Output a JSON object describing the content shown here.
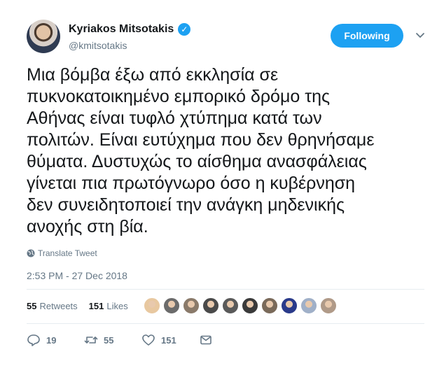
{
  "user": {
    "name": "Kyriakos Mitsotakis",
    "handle": "@kmitsotakis",
    "follow_label": "Following"
  },
  "tweet": {
    "text": "Μια βόμβα έξω από εκκλησία σε\nπυκνοκατοικημένο εμπορικό δρόμο της\nΑθήνας είναι τυφλό χτύπημα κατά των\nπολιτών. Είναι ευτύχημα που δεν θρηνήσαμε\nθύματα. Δυστυχώς το αίσθημα ανασφάλειας\nγίνεται πια πρωτόγνωρο όσο η κυβέρνηση\nδεν συνειδητοποιεί την ανάγκη μηδενικής\nανοχής στη βία.",
    "translate_label": "Translate Tweet",
    "timestamp": "2:53 PM - 27 Dec 2018"
  },
  "stats": {
    "retweets_count": "55",
    "retweets_label": "Retweets",
    "likes_count": "151",
    "likes_label": "Likes"
  },
  "liker_avatars": [
    {
      "color": "#e8c8a0"
    },
    {
      "color": "#6b6b6b"
    },
    {
      "color": "#8a7a6a"
    },
    {
      "color": "#4a4a4a"
    },
    {
      "color": "#5a5a5a"
    },
    {
      "color": "#3a3a3a"
    },
    {
      "color": "#7a6a5a"
    },
    {
      "color": "#2a3a8a"
    },
    {
      "color": "#a0b0c8"
    },
    {
      "color": "#b09a88"
    }
  ],
  "actions": {
    "replies": "19",
    "retweets": "55",
    "likes": "151"
  },
  "colors": {
    "accent": "#1da1f2",
    "muted": "#657786",
    "divider": "#e6ecf0"
  }
}
